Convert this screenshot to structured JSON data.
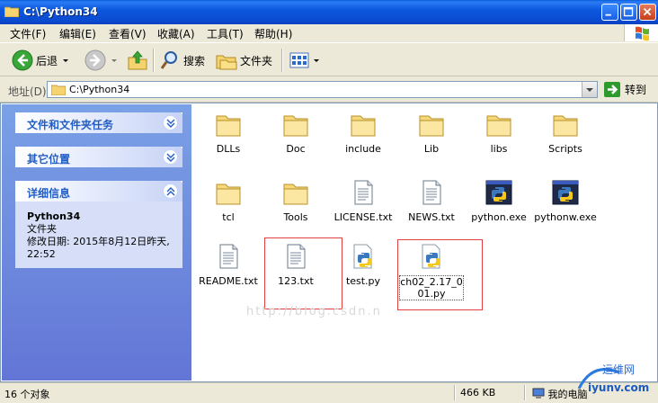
{
  "window": {
    "title": "C:\\Python34"
  },
  "menu": [
    {
      "label": "文件(F)"
    },
    {
      "label": "编辑(E)"
    },
    {
      "label": "查看(V)"
    },
    {
      "label": "收藏(A)"
    },
    {
      "label": "工具(T)"
    },
    {
      "label": "帮助(H)"
    }
  ],
  "toolbar": {
    "back_label": "后退",
    "search_label": "搜索",
    "folders_label": "文件夹"
  },
  "address": {
    "label": "地址(D)",
    "value": "C:\\Python34",
    "go_label": "转到"
  },
  "sidebar": {
    "tasks_title": "文件和文件夹任务",
    "places_title": "其它位置",
    "details_title": "详细信息",
    "details": {
      "name": "Python34",
      "type": "文件夹",
      "modified": "修改日期: 2015年8月12日昨天, 22:52"
    }
  },
  "files": [
    {
      "name": "DLLs",
      "icon": "folder-icon"
    },
    {
      "name": "Doc",
      "icon": "folder-icon"
    },
    {
      "name": "include",
      "icon": "folder-icon"
    },
    {
      "name": "Lib",
      "icon": "folder-icon"
    },
    {
      "name": "libs",
      "icon": "folder-icon"
    },
    {
      "name": "Scripts",
      "icon": "folder-icon"
    },
    {
      "name": "tcl",
      "icon": "folder-icon"
    },
    {
      "name": "Tools",
      "icon": "folder-icon"
    },
    {
      "name": "LICENSE.txt",
      "icon": "text-file-icon"
    },
    {
      "name": "NEWS.txt",
      "icon": "text-file-icon"
    },
    {
      "name": "python.exe",
      "icon": "python-exe-icon"
    },
    {
      "name": "pythonw.exe",
      "icon": "python-exe-icon"
    },
    {
      "name": "README.txt",
      "icon": "text-file-icon"
    },
    {
      "name": "123.txt",
      "icon": "text-file-icon"
    },
    {
      "name": "test.py",
      "icon": "python-file-icon"
    },
    {
      "name": "ch02_2.17_001.py",
      "icon": "python-file-icon"
    }
  ],
  "watermark_text": "http://blog.csdn.n",
  "status": {
    "objects": "16 个对象",
    "size": "466 KB",
    "location": "我的电脑"
  },
  "brand": {
    "text": "运维网",
    "url_text": "iyunv.com"
  },
  "colors": {
    "title_bar": "#0a5ed9",
    "sidebar": "#7aa1e6",
    "highlight_box": "#e04040"
  }
}
